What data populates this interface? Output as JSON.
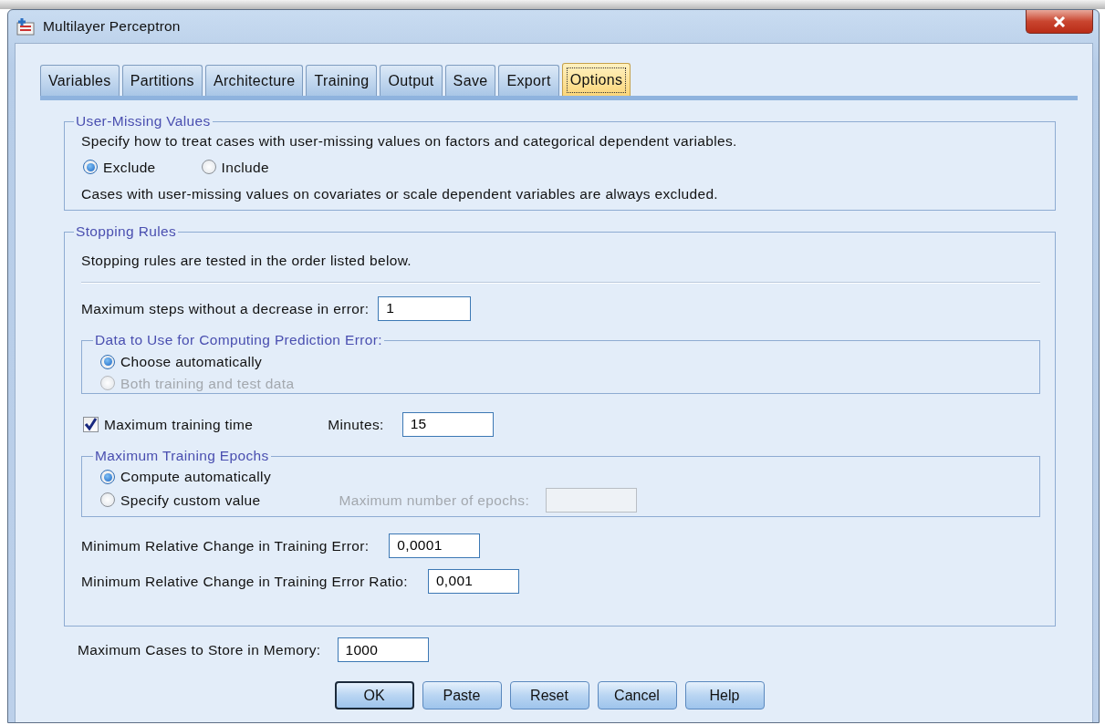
{
  "window": {
    "title": "Multilayer Perceptron"
  },
  "tabs": [
    {
      "label": "Variables",
      "selected": false
    },
    {
      "label": "Partitions",
      "selected": false
    },
    {
      "label": "Architecture",
      "selected": false
    },
    {
      "label": "Training",
      "selected": false
    },
    {
      "label": "Output",
      "selected": false
    },
    {
      "label": "Save",
      "selected": false
    },
    {
      "label": "Export",
      "selected": false
    },
    {
      "label": "Options",
      "selected": true
    }
  ],
  "user_missing": {
    "title": "User-Missing Values",
    "description": "Specify how to treat cases with user-missing values on factors and categorical dependent variables.",
    "options": [
      {
        "label": "Exclude",
        "selected": true,
        "disabled": false
      },
      {
        "label": "Include",
        "selected": false,
        "disabled": false
      }
    ],
    "note": "Cases with user-missing values on covariates or scale dependent variables are always excluded."
  },
  "stopping_rules": {
    "title": "Stopping Rules",
    "description": "Stopping rules are tested in the order listed below.",
    "max_steps": {
      "label": "Maximum steps without a decrease in error:",
      "value": "1"
    },
    "prediction_error": {
      "title": "Data to Use for Computing Prediction Error:",
      "options": [
        {
          "label": "Choose automatically",
          "selected": true,
          "disabled": false
        },
        {
          "label": "Both training and test data",
          "selected": false,
          "disabled": true
        }
      ]
    },
    "max_training_time": {
      "label": "Maximum training time",
      "checked": true,
      "minutes_label": "Minutes:",
      "minutes_value": "15"
    },
    "epochs": {
      "title": "Maximum Training Epochs",
      "options": [
        {
          "label": "Compute automatically",
          "selected": true,
          "disabled": false
        },
        {
          "label": "Specify custom value",
          "selected": false,
          "disabled": false
        }
      ],
      "custom_label": "Maximum number of epochs:",
      "custom_disabled": true
    },
    "min_change": {
      "label": "Minimum Relative Change in Training Error:",
      "value": "0,0001"
    },
    "min_change_ratio": {
      "label": "Minimum Relative Change in Training Error Ratio:",
      "value": "0,001"
    }
  },
  "max_cases": {
    "label": "Maximum Cases to Store in Memory:",
    "value": "1000"
  },
  "buttons": [
    {
      "label": "OK",
      "default": true
    },
    {
      "label": "Paste",
      "default": false
    },
    {
      "label": "Reset",
      "default": false
    },
    {
      "label": "Cancel",
      "default": false
    },
    {
      "label": "Help",
      "default": false
    }
  ]
}
